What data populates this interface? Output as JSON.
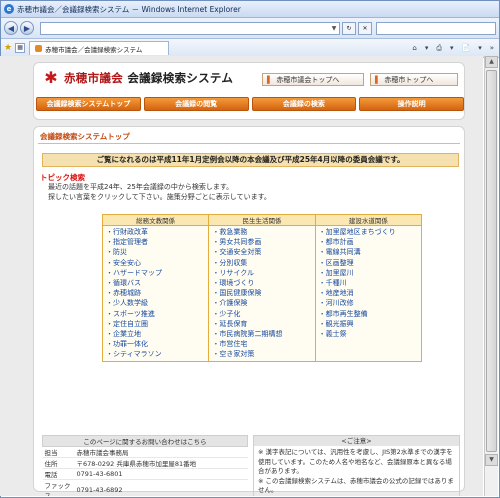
{
  "window": {
    "title": "赤穂市議会／会議録検索システム － Windows Internet Explorer",
    "tab_title": "赤穂市議会／会議録検索システム"
  },
  "browser": {
    "back": "◀",
    "forward": "▶",
    "star": "★",
    "tools": [
      "⌂",
      "▾",
      "⎙",
      "▾",
      "📄",
      "▾",
      "»"
    ]
  },
  "site": {
    "title_red": "赤穂市議会",
    "title_black": "会議録検索システム",
    "links": [
      "赤穂市議会トップへ",
      "赤穂市トップへ"
    ],
    "nav": [
      "会議録検索システムトップ",
      "会議録の閲覧",
      "会議録の検索",
      "操作説明"
    ]
  },
  "main": {
    "heading": "会議録検索システムトップ",
    "notice": "ご覧になれるのは平成11年1月定例会以降の本会議及び平成25年4月以降の委員会議です。",
    "topic_heading": "トピック検索",
    "topic_lines": [
      "最近の話題を平成24年、25年会議録の中から検索します。",
      "探したい言葉をクリックして下さい。施策分野ごとに表示しています。"
    ]
  },
  "topics": {
    "headers": [
      "総務文教関係",
      "民生生活関係",
      "建設水道関係"
    ],
    "col1": [
      "・行財政改革",
      "・指定管理者",
      "・防災",
      "・安全安心",
      "・ハザードマップ",
      "・循環バス",
      "・赤穂城跡",
      "・少人数学級",
      "・スポーツ推進",
      "・定住自立圏",
      "・企業立地",
      "・功罪一体化",
      "・シティマラソン"
    ],
    "col2": [
      "・救急業務",
      "・男女共同参画",
      "・交通安全対策",
      "・分別収集",
      "・リサイクル",
      "・環境づくり",
      "・国民健康保険",
      "・介護保険",
      "・少子化",
      "・延長保育",
      "・市民病院第二期構想",
      "・市営住宅",
      "・空き家対策"
    ],
    "col3": [
      "・加里屋地区まちづくり",
      "・都市計画",
      "・電線共同溝",
      "・区画整理",
      "・加里屋川",
      "・千種川",
      "・地産地消",
      "・河川改修",
      "・都市再生整備",
      "・観光振興",
      "・義士祭"
    ]
  },
  "contact": {
    "heading": "このページに関するお問い合わせはこちら",
    "rows": [
      {
        "k": "担当",
        "v": "赤穂市議会事務局"
      },
      {
        "k": "住所",
        "v": "〒678-0292 兵庫県赤穂市加里屋81番地"
      },
      {
        "k": "電話",
        "v": "0791-43-6801"
      },
      {
        "k": "ファックス",
        "v": "0791-43-6892"
      }
    ]
  },
  "caution": {
    "heading": "<ご注意>",
    "lines": [
      "※ 漢字表記については、汎用性を考慮し、JIS第2水準までの漢字を使用しています。このため人名や地名など、会議録原本と異なる場合があります。",
      "※ この会議録検索システムは、赤穂市議会の公式の記録ではありません。"
    ]
  }
}
